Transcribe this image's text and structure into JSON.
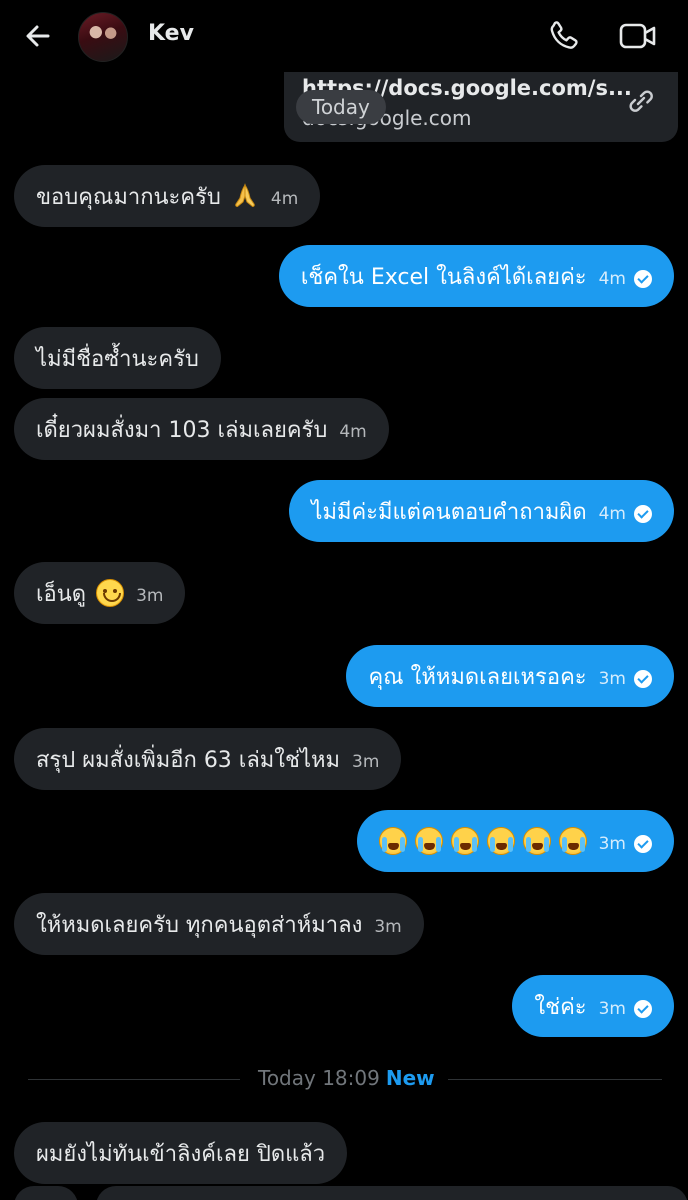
{
  "header": {
    "contact_name": "Kev"
  },
  "link_preview": {
    "url": "https://docs.google.com/s...",
    "domain": "docs.google.com"
  },
  "today_chip": "Today",
  "messages": [
    {
      "dir": "in",
      "text": "ขอบคุณมากนะครับ",
      "emoji": "folded-hands",
      "time": "4m"
    },
    {
      "dir": "out",
      "text": "เช็คใน Excel ในลิงค์ได้เลยค่ะ",
      "time": "4m"
    },
    {
      "dir": "in",
      "text": "ไม่มีชื่อซ้ำนะครับ",
      "time": ""
    },
    {
      "dir": "in",
      "text": "เดี๋ยวผมสั่งมา 103 เล่มเลยครับ",
      "time": "4m"
    },
    {
      "dir": "out",
      "text": "ไม่มีค่ะมีแต่คนตอบคำถามผิด",
      "time": "4m"
    },
    {
      "dir": "in",
      "text": "เอ็นดู",
      "emoji": "smiling-face",
      "time": "3m"
    },
    {
      "dir": "out",
      "text": "คุณ ให้หมดเลยเหรอคะ",
      "time": "3m"
    },
    {
      "dir": "in",
      "text": "สรุป ผมสั่งเพิ่มอีก 63 เล่มใช่ไหม",
      "time": "3m"
    },
    {
      "dir": "out",
      "text": "",
      "emoji": "loudly-crying-face x6",
      "time": "3m"
    },
    {
      "dir": "in",
      "text": "ให้หมดเลยครับ ทุกคนอุตส่าห์มาลง",
      "time": "3m"
    },
    {
      "dir": "out",
      "text": "ใช่ค่ะ",
      "time": "3m"
    },
    {
      "dir": "in",
      "text": "ผมยังไม่ทันเข้าลิงค์เลย ปิดแล้ว",
      "time": ""
    }
  ],
  "separator": {
    "label": "Today 18:09",
    "new_label": "New"
  },
  "colors": {
    "accent": "#1d9bf0",
    "incoming_bubble": "#202327",
    "background": "#000000"
  }
}
